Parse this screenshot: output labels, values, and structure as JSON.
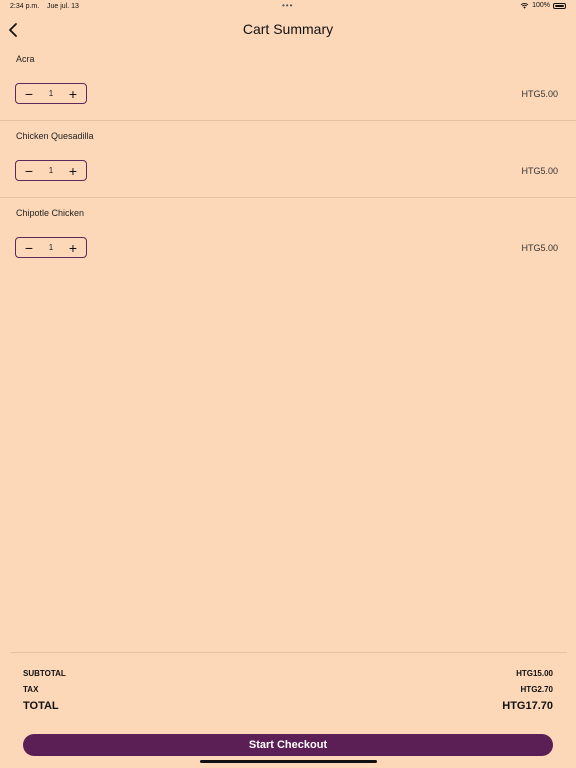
{
  "status_bar": {
    "time": "2:34 p.m.",
    "date": "Jue jul. 13",
    "dots": "•••",
    "battery": "100%"
  },
  "header": {
    "title": "Cart Summary",
    "back_icon": "chevron-left-icon"
  },
  "items": [
    {
      "name": "Acra",
      "quantity": "1",
      "price": "HTG5.00"
    },
    {
      "name": "Chicken Quesadilla",
      "quantity": "1",
      "price": "HTG5.00"
    },
    {
      "name": "Chipotle Chicken",
      "quantity": "1",
      "price": "HTG5.00"
    }
  ],
  "stepper": {
    "minus": "−",
    "plus": "+"
  },
  "summary": {
    "subtotal_label": "SUBTOTAL",
    "subtotal_value": "HTG15.00",
    "tax_label": "TAX",
    "tax_value": "HTG2.70",
    "total_label": "TOTAL",
    "total_value": "HTG17.70"
  },
  "checkout": {
    "label": "Start Checkout"
  },
  "colors": {
    "background": "#fcd8b8",
    "accent": "#5c1f55"
  }
}
